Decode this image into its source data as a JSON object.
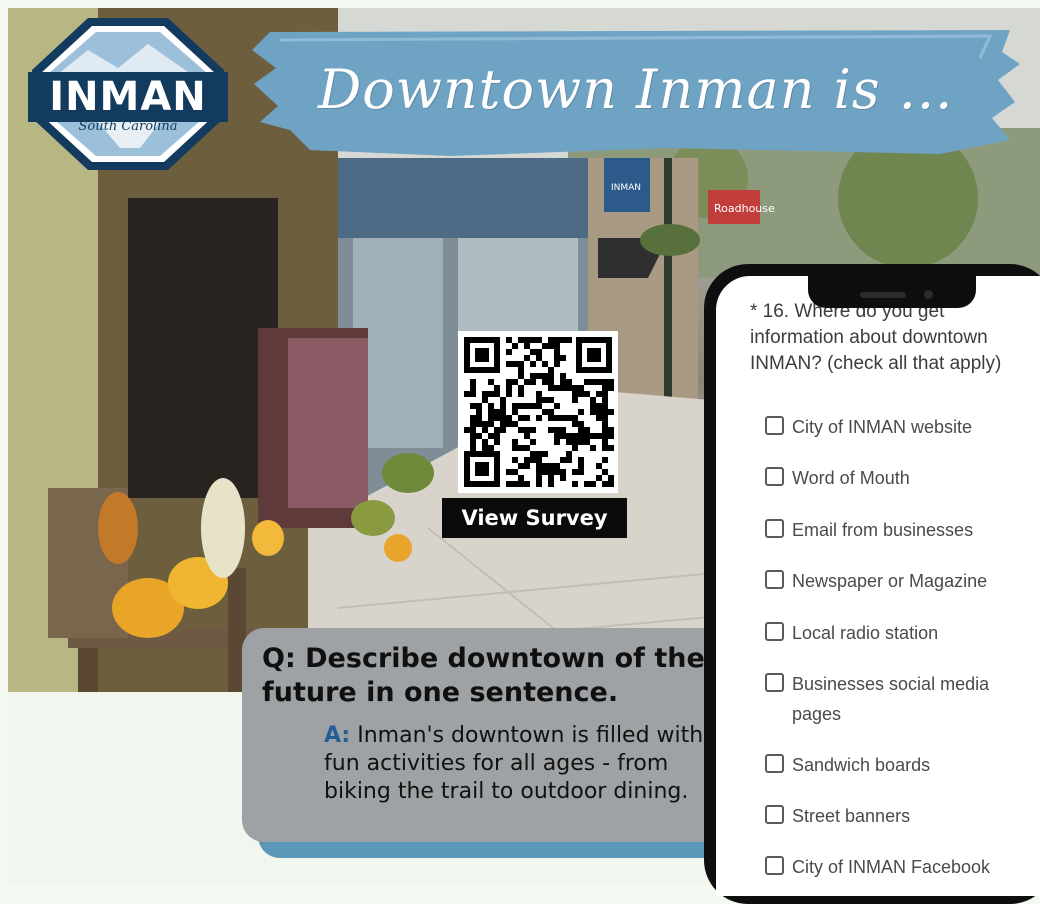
{
  "banner": {
    "headline": "Downtown Inman is ..."
  },
  "logo": {
    "name": "INMAN",
    "subtitle": "South Carolina"
  },
  "photo": {
    "shop_sign": "Roadhouse",
    "street_banner": "INMAN"
  },
  "survey_link": {
    "label": "View Survey"
  },
  "qa": {
    "question": "Q: Describe downtown of the future in one sentence.",
    "answer_prefix": "A:",
    "answer": "Inman's downtown is filled with fun activities for all ages - from biking the trail to outdoor dining."
  },
  "phone_survey": {
    "question": "* 16. Where do you get information about downtown INMAN? (check all that apply)",
    "options": [
      "City of INMAN website",
      "Word of Mouth",
      "Email from businesses",
      "Newspaper or Magazine",
      "Local radio station",
      "Businesses social media pages",
      "Sandwich boards",
      "Street banners",
      "City of INMAN Facebook"
    ]
  },
  "colors": {
    "brush_blue": "#6fa3c4",
    "logo_navy": "#123b5e",
    "qa_box": "#9fa2a4",
    "qa_shadow": "#5b97b8",
    "answer_prefix": "#235f96"
  }
}
